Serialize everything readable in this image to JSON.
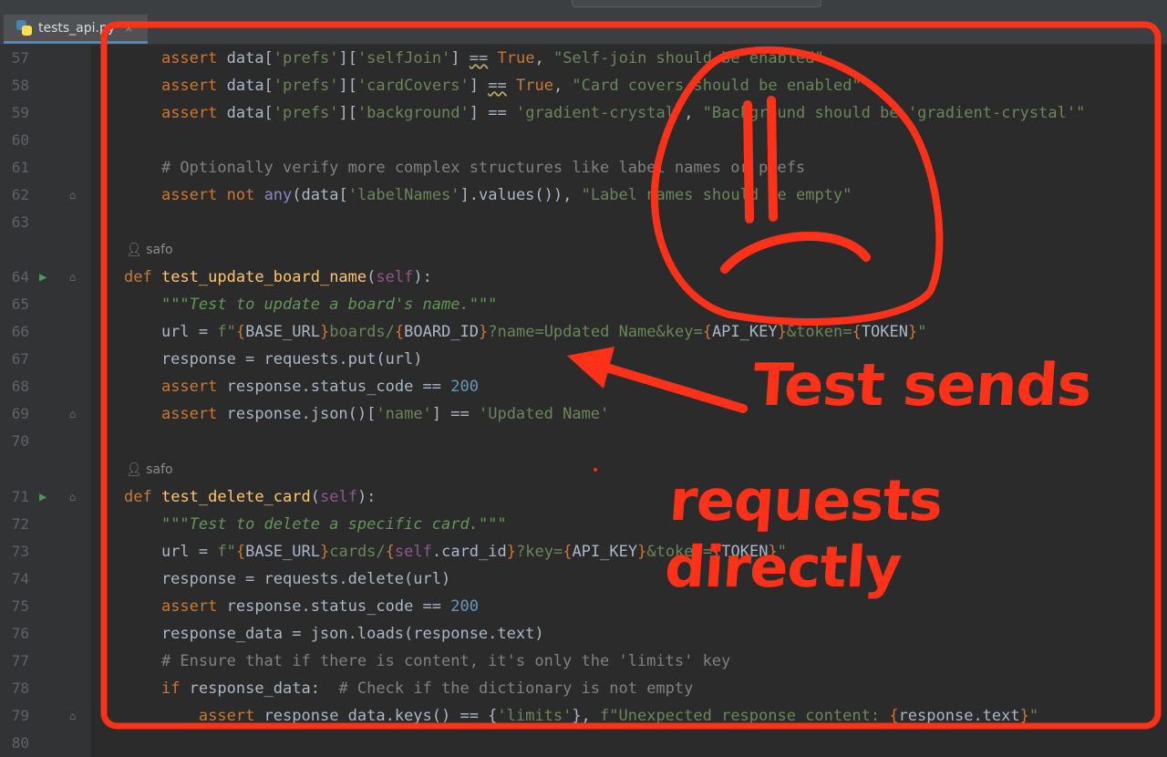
{
  "tab": {
    "filename": "tests_api.py",
    "close": "×"
  },
  "gutter_icons": {
    "run": "run-triangle-icon",
    "fold": "fold-marker-icon"
  },
  "hints": {
    "author": "safo",
    "author_icon": "person-icon"
  },
  "lines": {
    "57": "57",
    "58": "58",
    "59": "59",
    "60": "60",
    "61": "61",
    "62": "62",
    "63": "63",
    "64": "64",
    "65": "65",
    "66": "66",
    "67": "67",
    "68": "68",
    "69": "69",
    "70": "70",
    "71": "71",
    "72": "72",
    "73": "73",
    "74": "74",
    "75": "75",
    "76": "76",
    "77": "77",
    "78": "78",
    "79": "79",
    "80": "80"
  },
  "annotation": {
    "title": "Test sends",
    "subtitle": "requests directly",
    "color": "#ff3118"
  },
  "colors": {
    "background": "#2b2b2b",
    "gutter": "#313335",
    "keyword": "#cc7832",
    "string": "#6a8759",
    "comment": "#808080",
    "number": "#6897bb",
    "function": "#ffc66d",
    "self": "#94558d"
  }
}
